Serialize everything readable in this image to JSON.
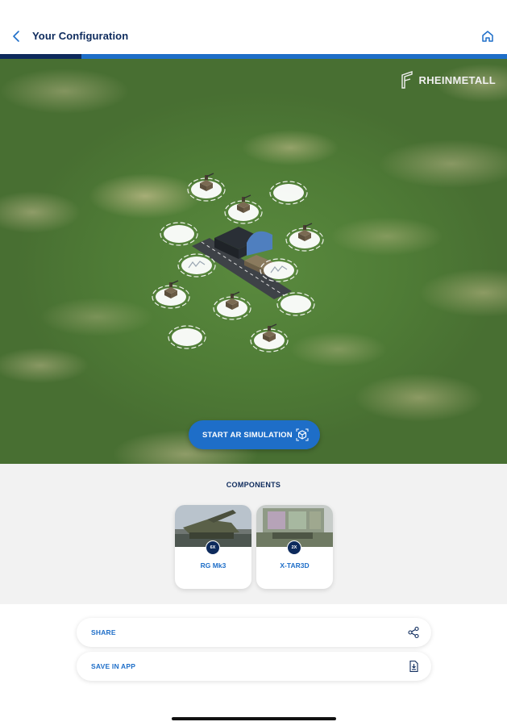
{
  "header": {
    "title": "Your Configuration",
    "back_icon": "chevron-left-icon",
    "home_icon": "home-icon"
  },
  "progress": {
    "fraction": 0.16
  },
  "ar_view": {
    "brand": "RHEINMETALL",
    "start_button_label": "START AR SIMULATION",
    "start_button_icon": "ar-cube-icon"
  },
  "components": {
    "title": "COMPONENTS",
    "items": [
      {
        "badge": "6X",
        "label": "RG Mk3"
      },
      {
        "badge": "2X",
        "label": "X-TAR3D"
      }
    ]
  },
  "actions": {
    "share_label": "SHARE",
    "share_icon": "share-icon",
    "save_label": "SAVE IN APP",
    "save_icon": "save-document-icon"
  },
  "colors": {
    "navy": "#0d2a5c",
    "accent_blue": "#1e6ec8",
    "panel_gray": "#f2f2f2"
  }
}
